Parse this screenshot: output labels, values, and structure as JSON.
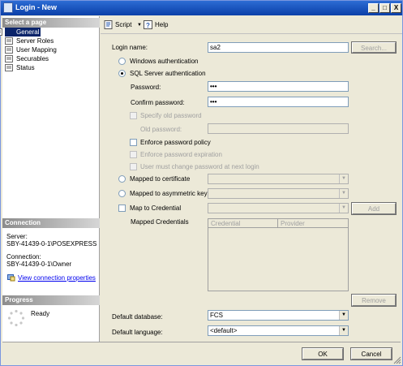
{
  "window": {
    "title": "Login - New",
    "controls": {
      "minimize": "_",
      "maximize": "□",
      "close": "X"
    }
  },
  "left": {
    "select_page_header": "Select a page",
    "pages": [
      "General",
      "Server Roles",
      "User Mapping",
      "Securables",
      "Status"
    ],
    "selected_page": "General",
    "connection_header": "Connection",
    "server_label": "Server:",
    "server_value": "SBY-41439-0-1\\POSEXPRESS",
    "connection_label": "Connection:",
    "connection_value": "SBY-41439-0-1\\Owner",
    "view_connection_link": "View connection properties",
    "progress_header": "Progress",
    "progress_status": "Ready"
  },
  "toolbar": {
    "script_label": "Script",
    "help_label": "Help"
  },
  "form": {
    "login_name_label": "Login name:",
    "login_name_value": "sa2",
    "search_label": "Search...",
    "windows_auth_label": "Windows authentication",
    "sql_auth_label": "SQL Server authentication",
    "auth_selected": "sql",
    "password_label": "Password:",
    "password_value": "•••",
    "confirm_password_label": "Confirm password:",
    "confirm_password_value": "•••",
    "specify_old_password_label": "Specify old password",
    "old_password_label": "Old password:",
    "enforce_policy_label": "Enforce password policy",
    "enforce_expiration_label": "Enforce password expiration",
    "must_change_label": "User must change password at next login",
    "mapped_cert_label": "Mapped to certificate",
    "mapped_asym_label": "Mapped to asymmetric key",
    "map_credential_label": "Map to Credential",
    "add_label": "Add",
    "mapped_credentials_label": "Mapped Credentials",
    "grid_columns": [
      "Credential",
      "Provider"
    ],
    "remove_label": "Remove",
    "default_database_label": "Default database:",
    "default_database_value": "FCS",
    "default_language_label": "Default language:",
    "default_language_value": "<default>"
  },
  "footer": {
    "ok_label": "OK",
    "cancel_label": "Cancel"
  }
}
